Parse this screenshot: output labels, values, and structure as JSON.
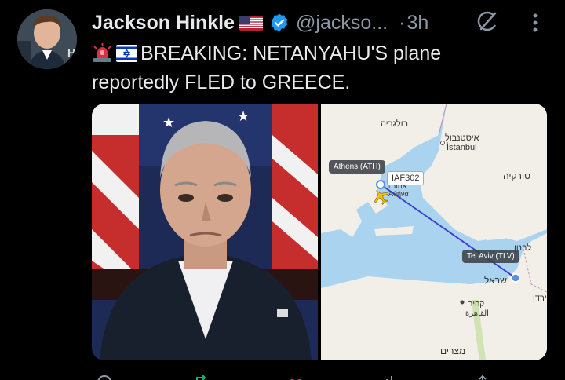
{
  "tweet": {
    "author_name": "Jackson Hinkle",
    "handle": "@jackso...",
    "separator": "·",
    "time": "3h",
    "text_line1": "BREAKING: NETANYAHU'S plane",
    "text_line2": "reportedly FLED to GREECE.",
    "emojis": [
      "rotating-light",
      "israel-flag"
    ]
  },
  "map": {
    "labels": {
      "bulgaria": "בולגריה",
      "istanbul_he": "איסטנבול",
      "istanbul_en": "İstanbul",
      "turkey": "טורקיה",
      "lebanon": "לבנון",
      "israel": "ישראל",
      "cairo_he": "קהיר",
      "cairo_ar": "القاهرة",
      "egypt": "מצרים",
      "jordan": "ירדן",
      "athens_he": "אתונה",
      "athens_gr": "Αθήνα"
    },
    "origin_tag": "Tel Aviv (TLV)",
    "destination_tag": "Athens (ATH)",
    "flight_code": "IAF302"
  },
  "colors": {
    "background": "#000000",
    "text": "#e7e9ea",
    "secondary": "#8b98a5",
    "verified": "#1d9bf0",
    "map_sea": "#a9d3ee",
    "map_land": "#f2efe9",
    "flight_path": "#3a3ad0",
    "plane": "#f5c400"
  },
  "icons": [
    "verified-badge-icon",
    "us-flag-icon",
    "grok-icon",
    "more-icon",
    "reply-icon",
    "repost-icon",
    "like-icon",
    "views-icon"
  ]
}
